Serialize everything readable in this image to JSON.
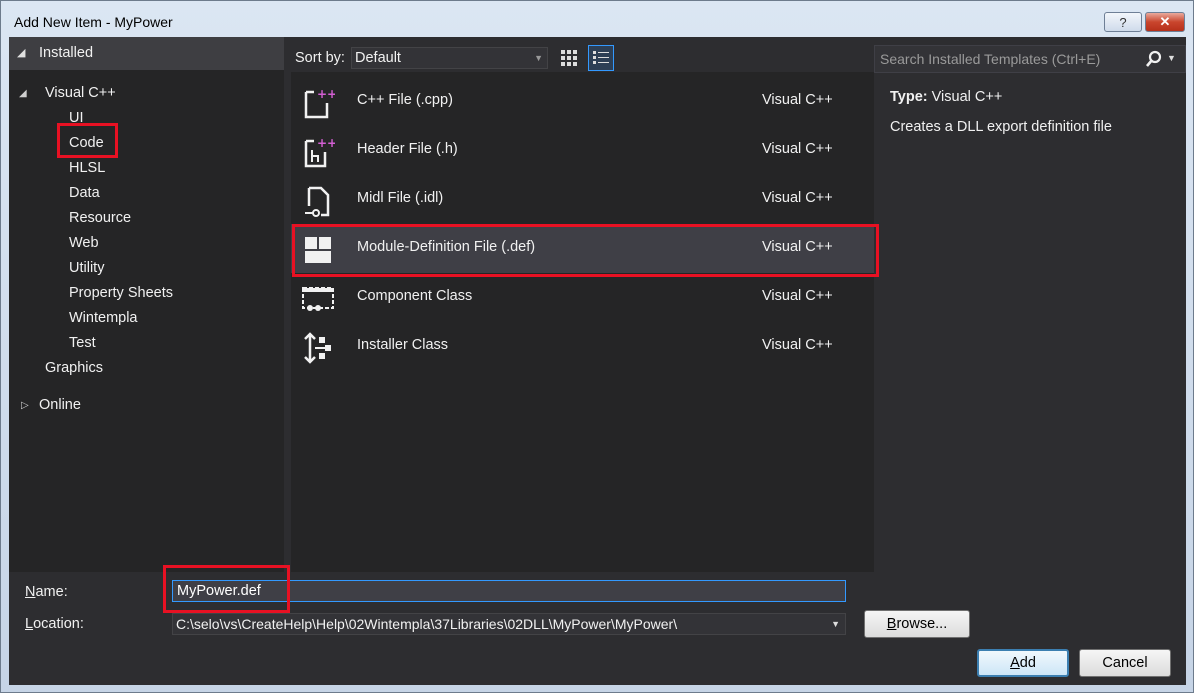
{
  "window": {
    "title": "Add New Item - MyPower",
    "help_label": "?",
    "close_label": "✕"
  },
  "tree": {
    "installed_label": "Installed",
    "visual_cpp_label": "Visual C++",
    "children": [
      "UI",
      "Code",
      "HLSL",
      "Data",
      "Resource",
      "Web",
      "Utility",
      "Property Sheets",
      "Wintempla",
      "Test"
    ],
    "graphics_label": "Graphics",
    "online_label": "Online",
    "selected": "Code"
  },
  "toolbar": {
    "sort_label": "Sort by:",
    "sort_value": "Default",
    "view_mode": "list"
  },
  "search": {
    "placeholder": "Search Installed Templates (Ctrl+E)"
  },
  "templates": [
    {
      "name": "C++ File (.cpp)",
      "lang": "Visual C++",
      "icon": "cpp-file-icon"
    },
    {
      "name": "Header File (.h)",
      "lang": "Visual C++",
      "icon": "header-file-icon"
    },
    {
      "name": "Midl File (.idl)",
      "lang": "Visual C++",
      "icon": "idl-file-icon"
    },
    {
      "name": "Module-Definition File (.def)",
      "lang": "Visual C++",
      "icon": "def-file-icon"
    },
    {
      "name": "Component Class",
      "lang": "Visual C++",
      "icon": "component-class-icon"
    },
    {
      "name": "Installer Class",
      "lang": "Visual C++",
      "icon": "installer-class-icon"
    }
  ],
  "selected_template": "Module-Definition File (.def)",
  "details": {
    "type_label": "Type:",
    "type_value": "Visual C++",
    "description": "Creates a DLL export definition file"
  },
  "form": {
    "name_label_accel": "N",
    "name_label_rest": "ame:",
    "name_value": "MyPower.def",
    "location_label_accel": "L",
    "location_label_rest": "ocation:",
    "location_value": "C:\\selo\\vs\\CreateHelp\\Help\\02Wintempla\\37Libraries\\02DLL\\MyPower\\MyPower\\"
  },
  "buttons": {
    "browse_accel": "B",
    "browse_rest": "rowse...",
    "add_accel": "A",
    "add_rest": "dd",
    "cancel": "Cancel"
  },
  "colors": {
    "highlight_box": "#e81123",
    "focus_border": "#3399ff",
    "dialog_bg": "#2d2d30"
  }
}
